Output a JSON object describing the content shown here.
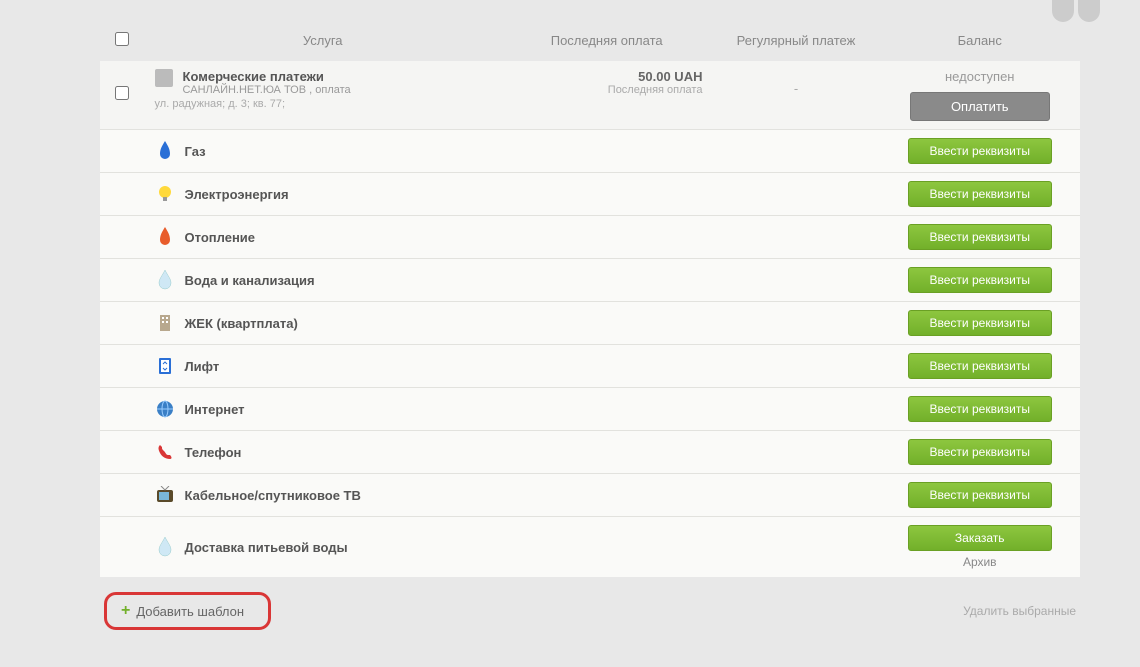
{
  "headers": {
    "service": "Услуга",
    "last_payment": "Последняя оплата",
    "recurring": "Регулярный платеж",
    "balance": "Баланс"
  },
  "main_item": {
    "title": "Комерческие платежи",
    "subtitle": "САНЛАЙН.НЕТ.ЮА ТОВ , оплата",
    "address": "ул. радужная; д. 3; кв. 77;",
    "amount": "50.00 UAH",
    "last_label": "Последняя оплата",
    "recurring": "-",
    "balance_label": "недоступен",
    "pay_button": "Оплатить"
  },
  "services": [
    {
      "name": "Газ",
      "icon": "gas-icon",
      "action": "Ввести реквизиты"
    },
    {
      "name": "Электроэнергия",
      "icon": "bulb-icon",
      "action": "Ввести реквизиты"
    },
    {
      "name": "Отопление",
      "icon": "flame-icon",
      "action": "Ввести реквизиты"
    },
    {
      "name": "Вода и канализация",
      "icon": "drop-icon",
      "action": "Ввести реквизиты"
    },
    {
      "name": "ЖЕК (квартплата)",
      "icon": "building-small-icon",
      "action": "Ввести реквизиты"
    },
    {
      "name": "Лифт",
      "icon": "elevator-icon",
      "action": "Ввести реквизиты"
    },
    {
      "name": "Интернет",
      "icon": "globe-icon",
      "action": "Ввести реквизиты"
    },
    {
      "name": "Телефон",
      "icon": "phone-icon",
      "action": "Ввести реквизиты"
    },
    {
      "name": "Кабельное/спутниковое ТВ",
      "icon": "tv-icon",
      "action": "Ввести реквизиты"
    },
    {
      "name": "Доставка питьевой воды",
      "icon": "drop-icon",
      "action": "Заказать",
      "archive": "Архив"
    }
  ],
  "footer": {
    "add_template": "Добавить шаблон",
    "delete_selected": "Удалить выбранные"
  }
}
